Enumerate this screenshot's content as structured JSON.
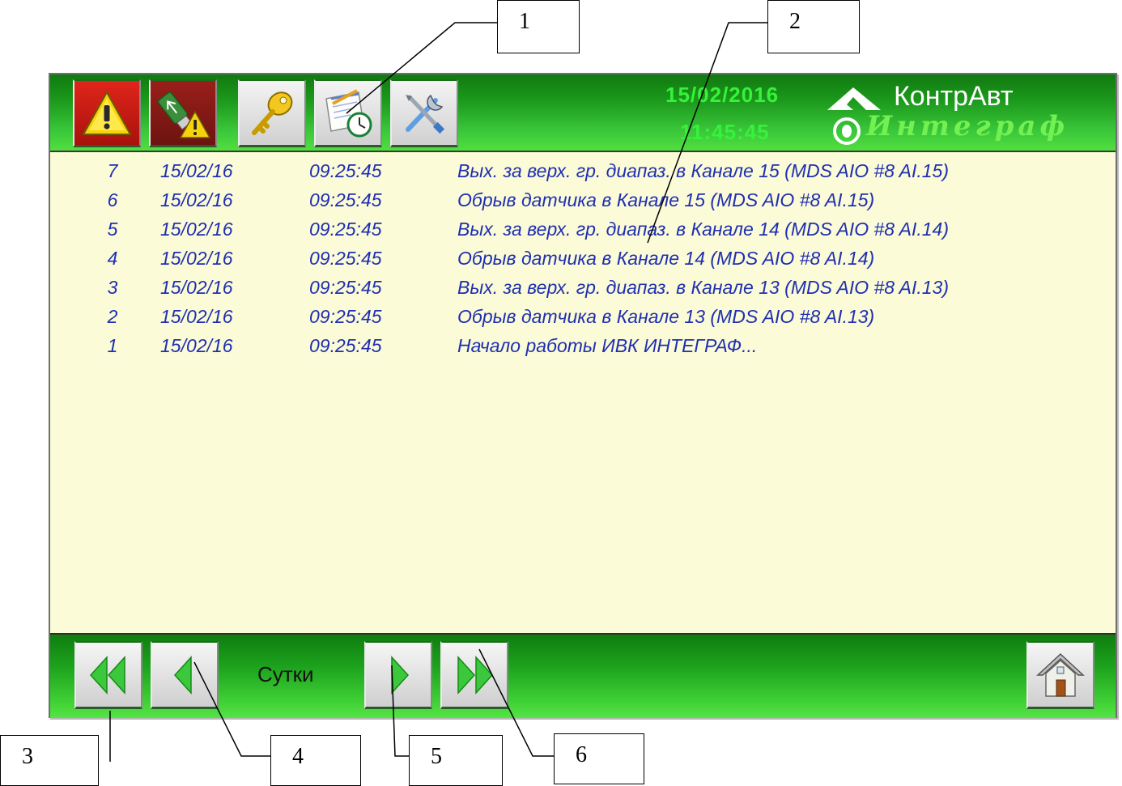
{
  "header": {
    "date": "15/02/2016",
    "time": "11:45:45",
    "brand_name": "КонтрАвт",
    "brand_sub": "Интеграф",
    "buttons": [
      {
        "name": "alarm-button",
        "icon": "warning-icon"
      },
      {
        "name": "usb-alarm-button",
        "icon": "usb-warning-icon"
      },
      {
        "name": "access-button",
        "icon": "key-icon"
      },
      {
        "name": "event-log-button",
        "icon": "notepad-clock-icon"
      },
      {
        "name": "settings-button",
        "icon": "tools-icon"
      }
    ]
  },
  "log": {
    "rows": [
      {
        "num": "7",
        "date": "15/02/16",
        "time": "09:25:45",
        "message": "Вых. за верх. гр. диапаз. в Канале 15 (MDS AIO #8 AI.15)"
      },
      {
        "num": "6",
        "date": "15/02/16",
        "time": "09:25:45",
        "message": "Обрыв датчика в Канале 15 (MDS AIO #8 AI.15)"
      },
      {
        "num": "5",
        "date": "15/02/16",
        "time": "09:25:45",
        "message": "Вых. за верх. гр. диапаз. в Канале 14 (MDS AIO #8 AI.14)"
      },
      {
        "num": "4",
        "date": "15/02/16",
        "time": "09:25:45",
        "message": "Обрыв датчика в Канале 14 (MDS AIO #8 AI.14)"
      },
      {
        "num": "3",
        "date": "15/02/16",
        "time": "09:25:45",
        "message": "Вых. за верх. гр. диапаз. в Канале 13 (MDS AIO #8 AI.13)"
      },
      {
        "num": "2",
        "date": "15/02/16",
        "time": "09:25:45",
        "message": "Обрыв датчика в Канале 13 (MDS AIO #8 AI.13)"
      },
      {
        "num": "1",
        "date": "15/02/16",
        "time": "09:25:45",
        "message": "Начало работы ИВК ИНТЕГРАФ..."
      }
    ]
  },
  "footer": {
    "period_label": "Сутки"
  },
  "callouts": [
    "1",
    "2",
    "3",
    "4",
    "5",
    "6"
  ],
  "colors": {
    "bar_green": "#1ea41e",
    "clock_green": "#36f23a",
    "log_text": "#1f2fb0",
    "log_background": "#fbfbd8",
    "arrow_green": "#3cc83c"
  }
}
